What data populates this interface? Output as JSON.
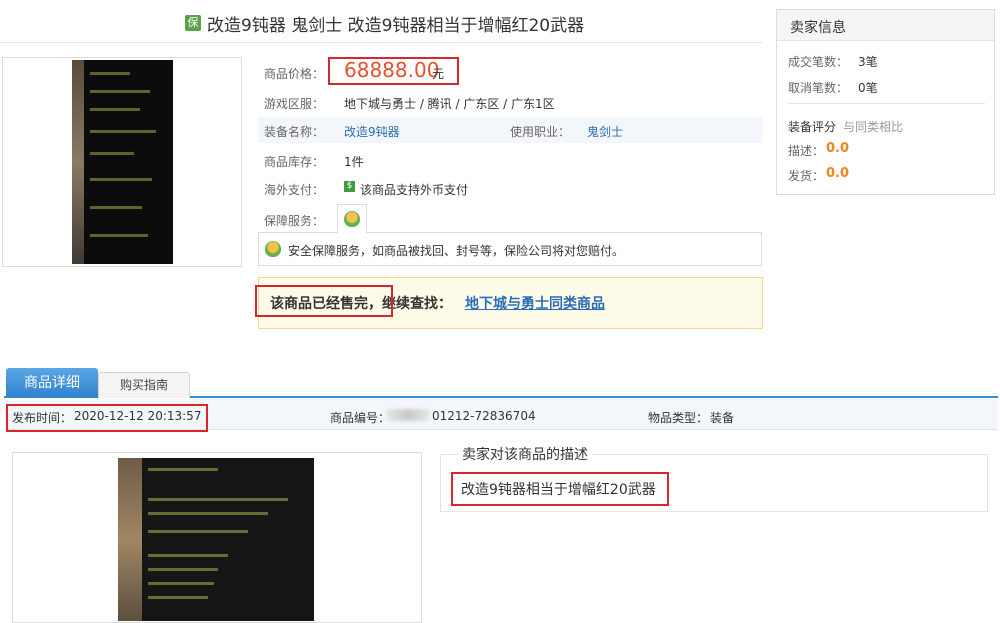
{
  "product": {
    "badge": "保",
    "title": "改造9钝器 鬼剑士 改造9钝器相当于增幅红20武器"
  },
  "info": {
    "price_label": "商品价格：",
    "price_value": "68888.00",
    "price_unit": "元",
    "server_label": "游戏区服：",
    "server_value": "地下城与勇士 / 腾讯 / 广东区 / 广东1区",
    "equip_label": "装备名称：",
    "equip_value": "改造9钝器",
    "job_label": "使用职业：",
    "job_value": "鬼剑士",
    "stock_label": "商品库存：",
    "stock_value": "1件",
    "overseas_label": "海外支付：",
    "overseas_value": "该商品支持外币支付",
    "guarantee_label": "保障服务：",
    "guarantee_text": "安全保障服务，如商品被找回、封号等，保险公司将对您赔付。",
    "sold_text": "该商品已经售完，",
    "continue_text": "继续查找：",
    "sold_link": "地下城与勇士同类商品"
  },
  "seller": {
    "title": "卖家信息",
    "deals_label": "成交笔数：",
    "deals_value": "3笔",
    "cancel_label": "取消笔数：",
    "cancel_value": "0笔",
    "rating_label": "装备评分",
    "rating_compare": "与同类相比",
    "desc_label": "描述：",
    "desc_score": "0.0",
    "ship_label": "发货：",
    "ship_score": "0.0"
  },
  "tabs": {
    "detail": "商品详细",
    "guide": "购买指南"
  },
  "meta": {
    "time_label": "发布时间：",
    "time_value": "2020-12-12 20:13:57",
    "no_label": "商品编号：",
    "no_value": "01212-72836704",
    "type_label": "物品类型：",
    "type_value": "装备"
  },
  "description": {
    "title": "卖家对该商品的描述",
    "text": "改造9钝器相当于增幅红20武器"
  },
  "colors": {
    "price": "#e5502d",
    "highlight_border": "#d9262c",
    "link": "#2a6eb8",
    "tab_active": "#2f82cc",
    "score": "#f08519"
  }
}
